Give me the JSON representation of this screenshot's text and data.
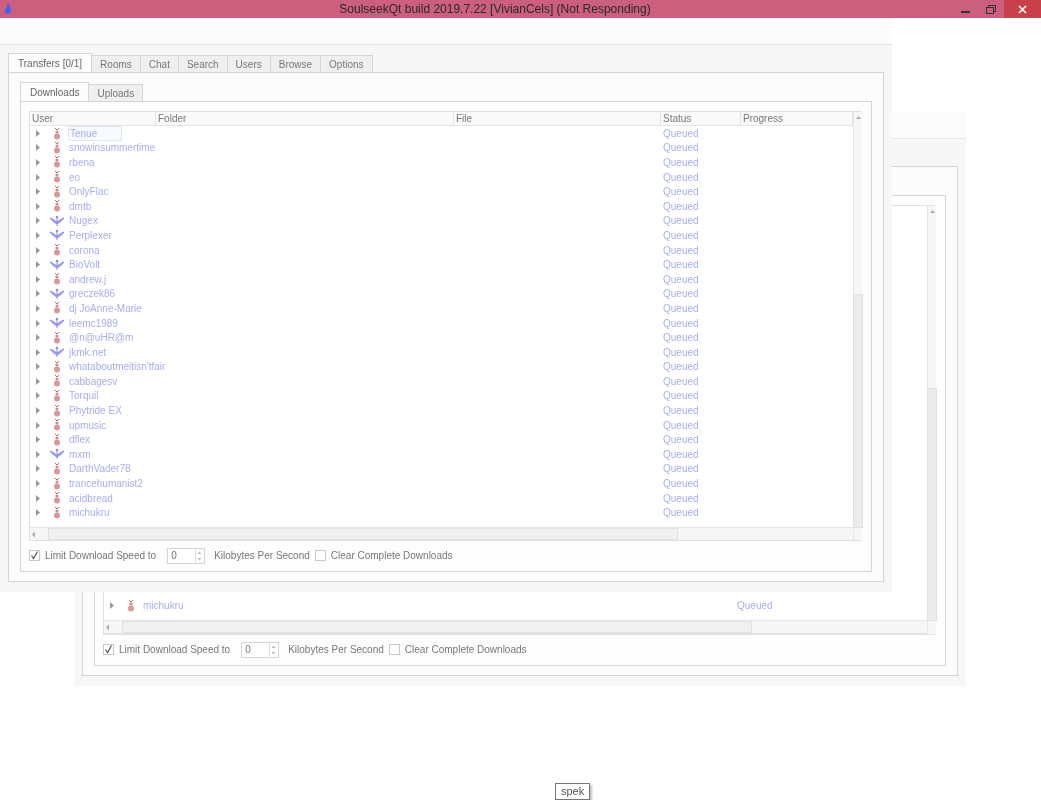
{
  "window": {
    "title": "SoulseekQt build 2019.7.22 [VivianCels] (Not Responding)"
  },
  "tabs": [
    {
      "label": "Transfers [0/1]",
      "selected": true
    },
    {
      "label": "Rooms",
      "selected": false
    },
    {
      "label": "Chat",
      "selected": false
    },
    {
      "label": "Search",
      "selected": false
    },
    {
      "label": "Users",
      "selected": false
    },
    {
      "label": "Browse",
      "selected": false
    },
    {
      "label": "Options",
      "selected": false
    }
  ],
  "subtabs": [
    {
      "label": "Downloads",
      "selected": true
    },
    {
      "label": "Uploads",
      "selected": false
    }
  ],
  "columns": [
    "User",
    "Folder",
    "File",
    "Status",
    "Progress"
  ],
  "rows": [
    {
      "kind": "person",
      "user": "Tenue",
      "status": "Queued",
      "selected": true,
      "expanded": false
    },
    {
      "kind": "person",
      "user": "snowinsummertime",
      "status": "Queued",
      "selected": false,
      "expanded": false
    },
    {
      "kind": "person",
      "user": "rbena",
      "status": "Queued",
      "selected": false,
      "expanded": false
    },
    {
      "kind": "person",
      "user": "eo",
      "status": "Queued",
      "selected": false,
      "expanded": false
    },
    {
      "kind": "person",
      "user": "OnlyFlac",
      "status": "Queued",
      "selected": false,
      "expanded": false
    },
    {
      "kind": "person",
      "user": "dmtb",
      "status": "Queued",
      "selected": false,
      "expanded": false
    },
    {
      "kind": "bird",
      "user": "Nugex",
      "status": "Queued",
      "selected": false,
      "expanded": false
    },
    {
      "kind": "bird",
      "user": "Perplexer",
      "status": "Queued",
      "selected": false,
      "expanded": false
    },
    {
      "kind": "person",
      "user": "corona",
      "status": "Queued",
      "selected": false,
      "expanded": false
    },
    {
      "kind": "bird",
      "user": "BioVolt",
      "status": "Queued",
      "selected": false,
      "expanded": false
    },
    {
      "kind": "person",
      "user": "andrew.j",
      "status": "Queued",
      "selected": false,
      "expanded": false
    },
    {
      "kind": "bird",
      "user": "greczek86",
      "status": "Queued",
      "selected": false,
      "expanded": false
    },
    {
      "kind": "person",
      "user": "dj JoAnne-Marie",
      "status": "Queued",
      "selected": false,
      "expanded": false
    },
    {
      "kind": "bird",
      "user": "leemc1989",
      "status": "Queued",
      "selected": false,
      "expanded": false
    },
    {
      "kind": "person",
      "user": "@n@uHR@m",
      "status": "Queued",
      "selected": false,
      "expanded": false
    },
    {
      "kind": "bird",
      "user": "jkmk.net",
      "status": "Queued",
      "selected": false,
      "expanded": false
    },
    {
      "kind": "person",
      "user": "whataboutmeitisn'tfair",
      "status": "Queued",
      "selected": false,
      "expanded": false
    },
    {
      "kind": "person",
      "user": "cabbagesv",
      "status": "Queued",
      "selected": false,
      "expanded": false
    },
    {
      "kind": "person",
      "user": "Torquil",
      "status": "Queued",
      "selected": false,
      "expanded": false
    },
    {
      "kind": "person",
      "user": "Phytride EX",
      "status": "Queued",
      "selected": false,
      "expanded": false
    },
    {
      "kind": "person",
      "user": "upmusic",
      "status": "Queued",
      "selected": false,
      "expanded": false
    },
    {
      "kind": "person",
      "user": "dflex",
      "status": "Queued",
      "selected": false,
      "expanded": false
    },
    {
      "kind": "bird",
      "user": "mxm",
      "status": "Queued",
      "selected": false,
      "expanded": false
    },
    {
      "kind": "person",
      "user": "DarthVader78",
      "status": "Queued",
      "selected": false,
      "expanded": false
    },
    {
      "kind": "person",
      "user": "trancehumanist2",
      "status": "Queued",
      "selected": false,
      "expanded": false
    },
    {
      "kind": "person",
      "user": "acidbread",
      "status": "Queued",
      "selected": false,
      "expanded": false
    },
    {
      "kind": "person",
      "user": "michukru",
      "status": "Queued",
      "selected": false,
      "expanded": false
    }
  ],
  "limit_speed": {
    "label": "Limit Download Speed to",
    "checked": true,
    "value": "0",
    "unit": "Kilobytes Per Second"
  },
  "clear_complete": {
    "label": "Clear Complete Downloads",
    "checked": false
  },
  "ghost_window": {
    "rows": [
      {
        "kind": "person",
        "user": "michukru",
        "status": "Queued",
        "selected": false,
        "expanded": false
      }
    ],
    "limit_speed": {
      "label": "Limit Download Speed to",
      "checked": true,
      "value": "0",
      "unit": "Kilobytes Per Second"
    },
    "clear_complete": {
      "label": "Clear Complete Downloads",
      "checked": false
    }
  },
  "tooltip": "spek"
}
